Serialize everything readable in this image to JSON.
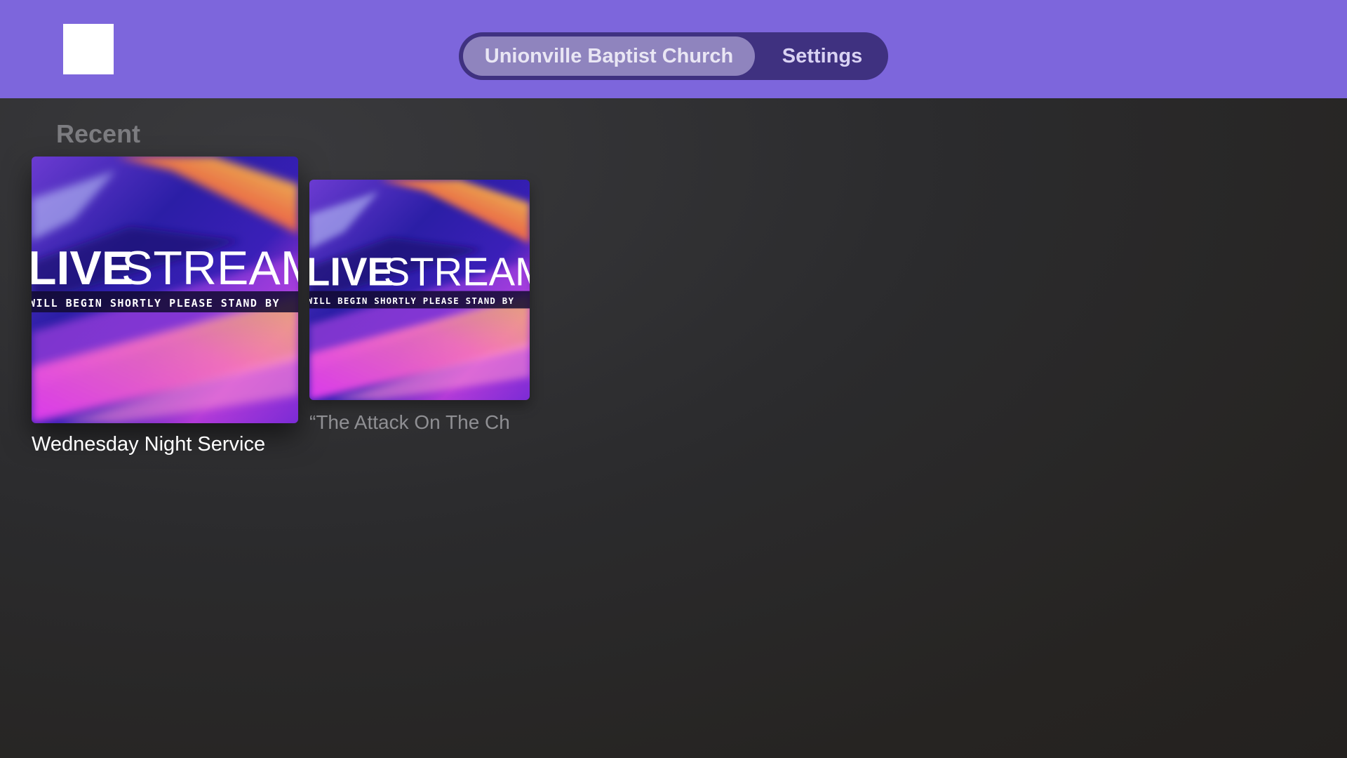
{
  "header": {
    "logo_icon": "app-logo",
    "tabs": [
      {
        "label": "Unionville Baptist Church",
        "focused": true
      },
      {
        "label": "Settings",
        "focused": false
      }
    ]
  },
  "main": {
    "section_title": "Recent",
    "items": [
      {
        "title": "Wednesday Night Service",
        "thumbnail": {
          "headline_left": "LIVE",
          "headline_right": "STREAM",
          "tagline": "WILL BEGIN SHORTLY PLEASE STAND BY"
        },
        "focused": true
      },
      {
        "title": "“The Attack On The Ch",
        "thumbnail": {
          "headline_left": "LIVE",
          "headline_right": "STREAM",
          "tagline": "WILL BEGIN SHORTLY PLEASE STAND BY"
        },
        "focused": false
      }
    ]
  },
  "colors": {
    "header_background": "#7d66dc",
    "tab_bar": "#3f3180",
    "focused_tab": "#8f84be"
  }
}
